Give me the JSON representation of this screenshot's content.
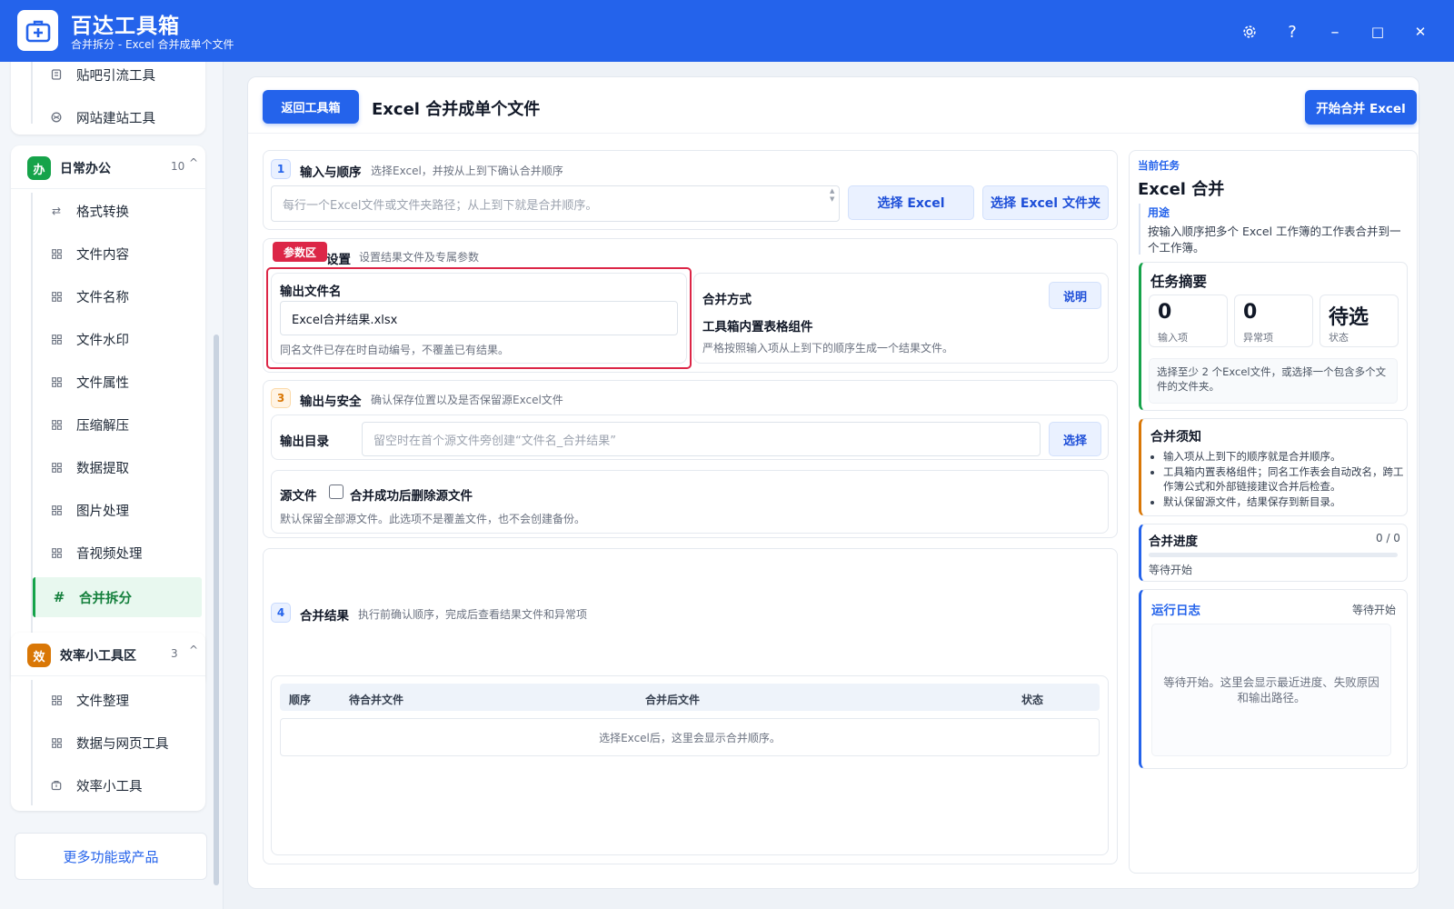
{
  "app": {
    "title": "百达工具箱",
    "subtitle": "合并拆分 - Excel 合并成单个文件",
    "window_buttons": [
      "gear-icon",
      "help-icon",
      "minimize-icon",
      "maximize-icon",
      "close-icon"
    ],
    "help_glyph": "?",
    "minimize_glyph": "–",
    "maximize_glyph": "□",
    "close_glyph": "✕"
  },
  "sidebar": {
    "top_items": [
      {
        "label": "贴吧引流工具",
        "icon": "doc-icon"
      },
      {
        "label": "网站建站工具",
        "icon": "globe-icon"
      }
    ],
    "groups": [
      {
        "badge": "办",
        "badge_color": "#16a34a",
        "title": "日常办公",
        "count": "10",
        "chevron": "^",
        "items": [
          {
            "label": "格式转换",
            "icon": "swap-icon"
          },
          {
            "label": "文件内容",
            "icon": "grid-icon"
          },
          {
            "label": "文件名称",
            "icon": "grid-icon"
          },
          {
            "label": "文件水印",
            "icon": "grid-icon"
          },
          {
            "label": "文件属性",
            "icon": "grid-icon"
          },
          {
            "label": "压缩解压",
            "icon": "grid-icon"
          },
          {
            "label": "数据提取",
            "icon": "grid-icon"
          },
          {
            "label": "图片处理",
            "icon": "grid-icon"
          },
          {
            "label": "音视频处理",
            "icon": "grid-icon"
          },
          {
            "label": "合并拆分",
            "icon": "hash-icon",
            "active": true
          }
        ]
      },
      {
        "badge": "效",
        "badge_color": "#d97706",
        "title": "效率小工具区",
        "count": "3",
        "chevron": "^",
        "items": [
          {
            "label": "文件整理",
            "icon": "grid-icon"
          },
          {
            "label": "数据与网页工具",
            "icon": "grid-icon"
          },
          {
            "label": "效率小工具",
            "icon": "box-icon"
          }
        ]
      }
    ],
    "hash_glyph": "#",
    "more_label": "更多功能或产品"
  },
  "header": {
    "back_label": "返回工具箱",
    "title": "Excel 合并成单个文件",
    "start_label": "开始合并 Excel"
  },
  "step1": {
    "num": "1",
    "title": "输入与顺序",
    "desc": "选择Excel，并按从上到下确认合并顺序",
    "textarea_placeholder": "每行一个Excel文件或文件夹路径；从上到下就是合并顺序。",
    "select_excel": "选择 Excel",
    "select_folder": "选择 Excel 文件夹"
  },
  "step2": {
    "tag": "参数区",
    "title": "设置",
    "desc": "设置结果文件及专属参数",
    "filename_label": "输出文件名",
    "filename_value": "Excel合并结果.xlsx",
    "filename_hint": "同名文件已存在时自动编号，不覆盖已有结果。",
    "merge_label": "合并方式",
    "explain_label": "说明",
    "merge_component": "工具箱内置表格组件",
    "merge_hint": "严格按照输入项从上到下的顺序生成一个结果文件。"
  },
  "step3": {
    "num": "3",
    "title": "输出与安全",
    "desc": "确认保存位置以及是否保留源Excel文件",
    "dir_label": "输出目录",
    "dir_placeholder": "留空时在首个源文件旁创建“文件名_合并结果”",
    "choose_label": "选择",
    "source_label": "源文件",
    "delete_label": "合并成功后删除源文件",
    "delete_checked": false,
    "source_hint": "默认保留全部源文件。此选项不是覆盖文件，也不会创建备份。"
  },
  "step4": {
    "num": "4",
    "title": "合并结果",
    "desc": "执行前确认顺序，完成后查看结果文件和异常项",
    "columns": [
      "顺序",
      "待合并文件",
      "合并后文件",
      "状态"
    ],
    "empty": "选择Excel后，这里会显示合并顺序。"
  },
  "right": {
    "current_label": "当前任务",
    "task_title": "Excel 合并",
    "purpose_label": "用途",
    "purpose_text": "按输入顺序把多个 Excel 工作簿的工作表合并到一个工作簿。",
    "summary_title": "任务摘要",
    "stats": [
      {
        "value": "0",
        "key": "输入项"
      },
      {
        "value": "0",
        "key": "异常项"
      },
      {
        "value": "待选",
        "key": "状态"
      }
    ],
    "summary_hint": "选择至少 2 个Excel文件，或选择一个包含多个文件的文件夹。",
    "notes_title": "合并须知",
    "notes": [
      "输入项从上到下的顺序就是合并顺序。",
      "工具箱内置表格组件；同名工作表会自动改名，跨工作簿公式和外部链接建议合并后检查。",
      "默认保留源文件，结果保存到新目录。"
    ],
    "progress_title": "合并进度",
    "progress_count": "0 / 0",
    "progress_fraction": 0,
    "progress_status": "等待开始",
    "log_title": "运行日志",
    "log_status": "等待开始",
    "log_empty": "等待开始。这里会显示最近进度、失败原因和输出路径。"
  },
  "colors": {
    "brand": "#2463eb",
    "green": "#16a34a",
    "orange": "#d97706",
    "red": "#dc2647"
  }
}
